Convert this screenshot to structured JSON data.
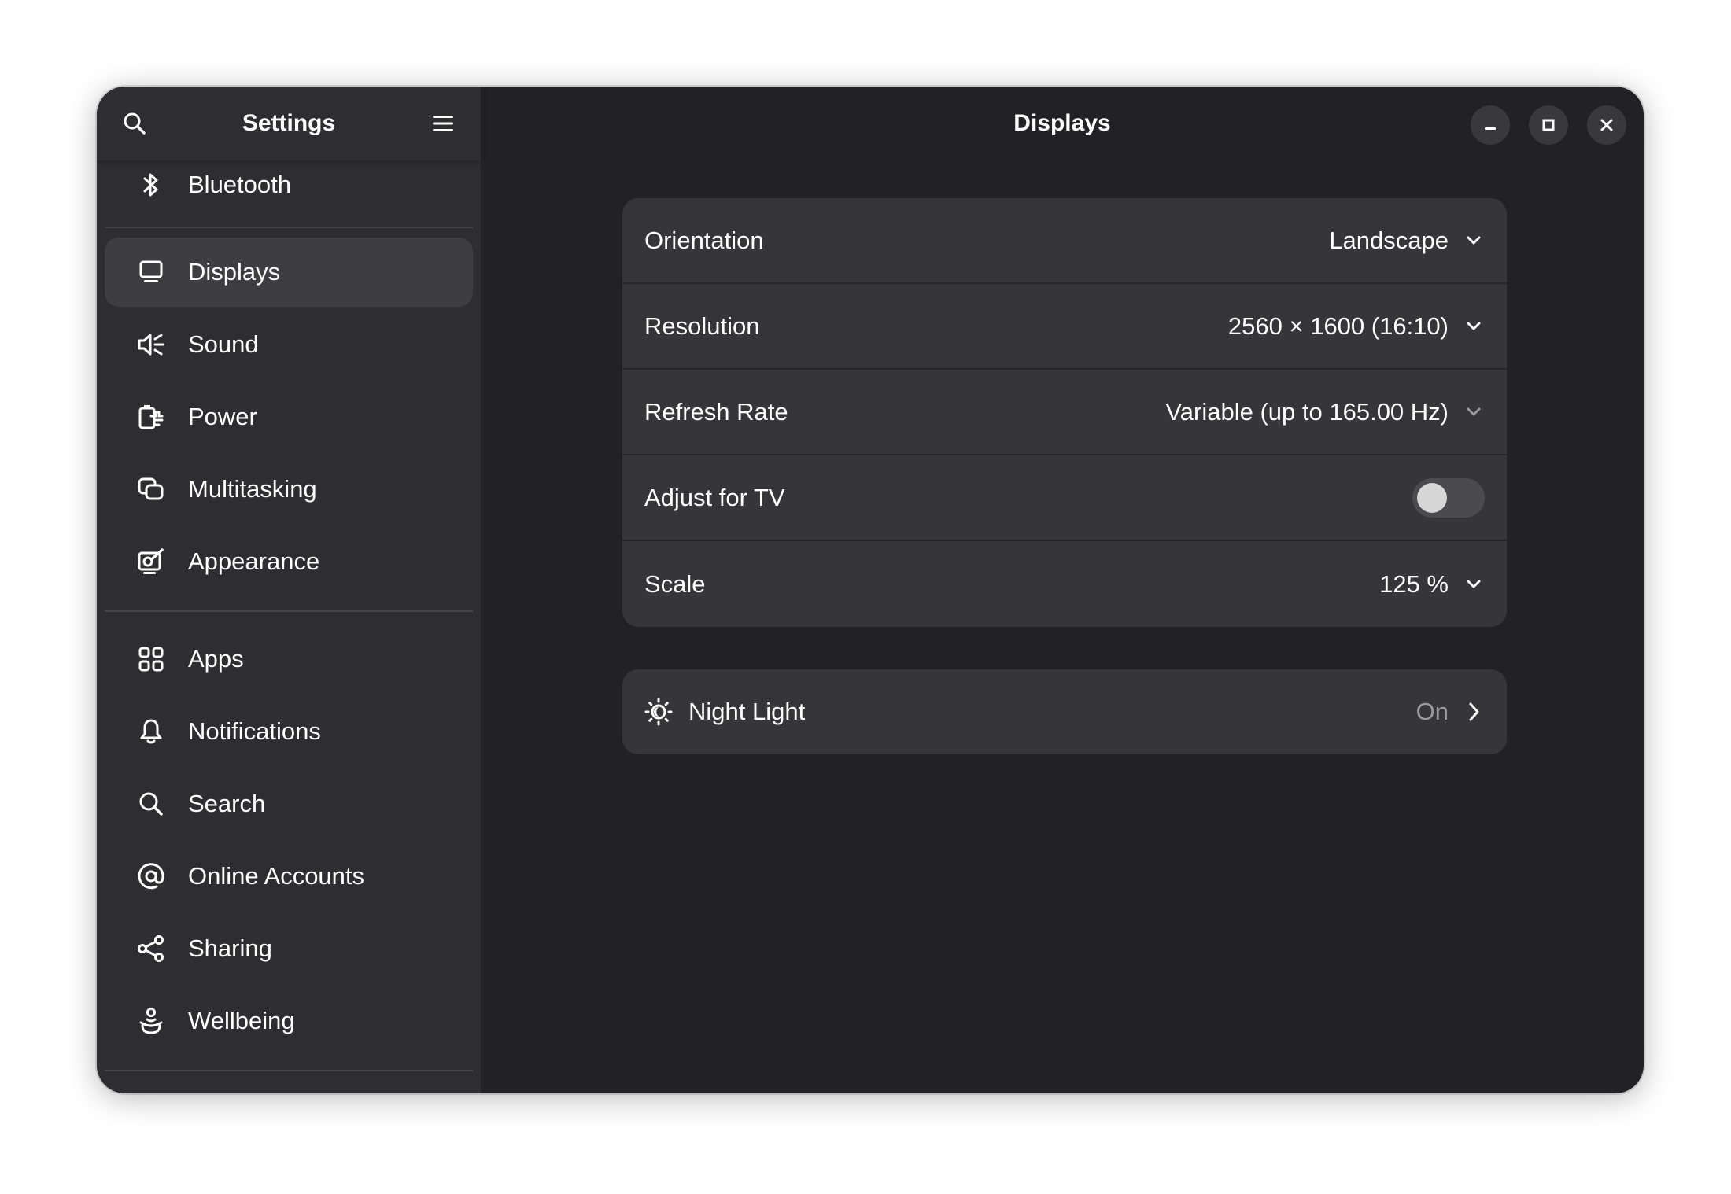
{
  "sidebar": {
    "title": "Settings",
    "items_top": [
      {
        "label": "Bluetooth",
        "icon": "bluetooth-icon"
      }
    ],
    "items_group1": [
      {
        "label": "Displays",
        "icon": "display-icon",
        "active": true
      },
      {
        "label": "Sound",
        "icon": "speaker-icon"
      },
      {
        "label": "Power",
        "icon": "power-plug-icon"
      },
      {
        "label": "Multitasking",
        "icon": "multitasking-icon"
      },
      {
        "label": "Appearance",
        "icon": "appearance-icon"
      }
    ],
    "items_group2": [
      {
        "label": "Apps",
        "icon": "apps-grid-icon"
      },
      {
        "label": "Notifications",
        "icon": "bell-icon"
      },
      {
        "label": "Search",
        "icon": "search-icon"
      },
      {
        "label": "Online Accounts",
        "icon": "at-sign-icon"
      },
      {
        "label": "Sharing",
        "icon": "share-icon"
      },
      {
        "label": "Wellbeing",
        "icon": "wellbeing-icon"
      }
    ]
  },
  "header": {
    "title": "Displays"
  },
  "display_settings": {
    "orientation": {
      "label": "Orientation",
      "value": "Landscape"
    },
    "resolution": {
      "label": "Resolution",
      "value": "2560 × 1600 (16:10)"
    },
    "refresh_rate": {
      "label": "Refresh Rate",
      "value": "Variable (up to 165.00 Hz)"
    },
    "adjust_for_tv": {
      "label": "Adjust for TV",
      "enabled": false
    },
    "scale": {
      "label": "Scale",
      "value": "125 %"
    }
  },
  "night_light": {
    "label": "Night Light",
    "status": "On"
  },
  "colors": {
    "window_bg": "#222226",
    "sidebar_bg": "#2e2e32",
    "card_bg": "#36363a",
    "active_item_bg": "#3d3d42"
  }
}
